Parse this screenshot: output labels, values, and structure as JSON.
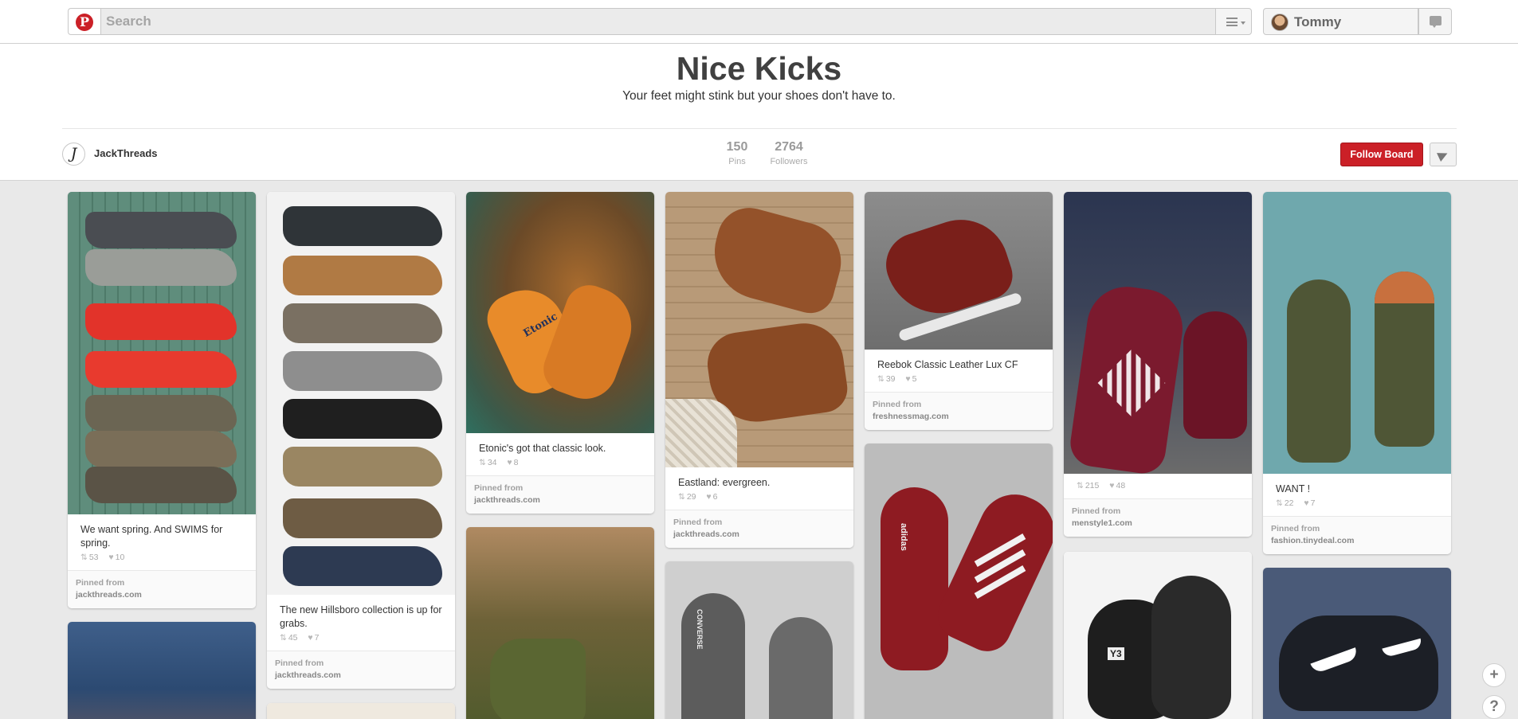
{
  "header": {
    "search_placeholder": "Search",
    "user_name": "Tommy"
  },
  "board": {
    "title": "Nice Kicks",
    "description": "Your feet might stink but your shoes don't have to.",
    "owner_initial": "J",
    "owner": "JackThreads",
    "pins_count": "150",
    "pins_label": "Pins",
    "followers_count": "2764",
    "followers_label": "Followers",
    "follow_label": "Follow Board"
  },
  "pins": [
    {
      "caption": "We want spring. And SWIMS for spring.",
      "repins": "53",
      "likes": "10",
      "pinned_from": "Pinned from",
      "source": "jackthreads.com"
    },
    {
      "caption": "The new Hillsboro collection is up for grabs.",
      "repins": "45",
      "likes": "7",
      "pinned_from": "Pinned from",
      "source": "jackthreads.com"
    },
    {
      "caption": "Etonic's got that classic look.",
      "repins": "34",
      "likes": "8",
      "pinned_from": "Pinned from",
      "source": "jackthreads.com"
    },
    {
      "caption": "Eastland: evergreen.",
      "repins": "29",
      "likes": "6",
      "pinned_from": "Pinned from",
      "source": "jackthreads.com"
    },
    {
      "caption": "Reebok Classic Leather Lux CF",
      "repins": "39",
      "likes": "5",
      "pinned_from": "Pinned from",
      "source": "freshnessmag.com"
    },
    {
      "caption": "",
      "repins": "215",
      "likes": "48",
      "pinned_from": "Pinned from",
      "source": "menstyle1.com"
    },
    {
      "caption": "WANT !",
      "repins": "22",
      "likes": "7",
      "pinned_from": "Pinned from",
      "source": "fashion.tinydeal.com"
    }
  ],
  "image_text": {
    "etonic": "Etonic",
    "converse": "CONVERSE",
    "adidas": "adidas",
    "y3": "Y3"
  },
  "icons": {
    "repin": "repin-icon",
    "like": "heart-icon",
    "logo": "pinterest-logo",
    "add": "plus-icon",
    "help": "help-icon"
  },
  "fab": {
    "add": "+",
    "help": "?"
  },
  "colors": {
    "brand_red": "#cb2027",
    "page_bg": "#e9e9e9"
  }
}
